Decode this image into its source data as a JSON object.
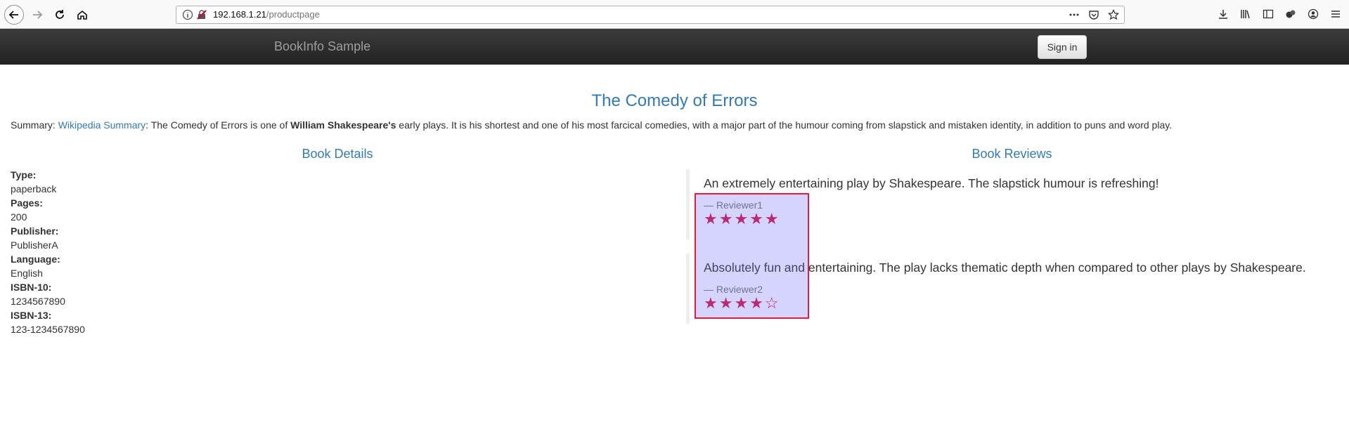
{
  "browser": {
    "url_host": "192.168.1.21",
    "url_path": "/productpage"
  },
  "navbar": {
    "brand": "BookInfo Sample",
    "signin_label": "Sign in"
  },
  "product": {
    "title": "The Comedy of Errors",
    "summary_prefix": "Summary: ",
    "summary_link": "Wikipedia Summary",
    "summary_mid": ": The Comedy of Errors is one of ",
    "summary_bold": "William Shakespeare's",
    "summary_rest": " early plays. It is his shortest and one of his most farcical comedies, with a major part of the humour coming from slapstick and mistaken identity, in addition to puns and word play."
  },
  "details": {
    "heading": "Book Details",
    "items": [
      {
        "label": "Type:",
        "value": "paperback"
      },
      {
        "label": "Pages:",
        "value": "200"
      },
      {
        "label": "Publisher:",
        "value": "PublisherA"
      },
      {
        "label": "Language:",
        "value": "English"
      },
      {
        "label": "ISBN-10:",
        "value": "1234567890"
      },
      {
        "label": "ISBN-13:",
        "value": "123-1234567890"
      }
    ]
  },
  "reviews": {
    "heading": "Book Reviews",
    "items": [
      {
        "text": "An extremely entertaining play by Shakespeare. The slapstick humour is refreshing!",
        "reviewer": "— Reviewer1",
        "rating": 5,
        "stars": "★★★★★"
      },
      {
        "text": "Absolutely fun and entertaining. The play lacks thematic depth when compared to other plays by Shakespeare.",
        "reviewer": "— Reviewer2",
        "rating": 4,
        "stars": "★★★★☆"
      }
    ],
    "star_color": "#dc143c"
  },
  "colors": {
    "link": "#337ab7",
    "navbar_bg": "#222222",
    "highlight_border": "#e8193c"
  }
}
